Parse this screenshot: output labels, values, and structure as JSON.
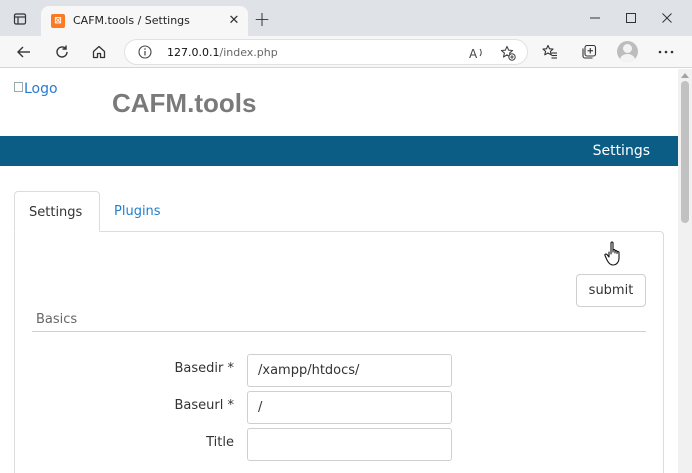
{
  "browser": {
    "tab_title": "CAFM.tools / Settings",
    "tab_close": "✕",
    "new_tab": "+",
    "url_host": "127.0.0.1",
    "url_path": "/index.php",
    "icons": [
      "tab-actions-icon",
      "favicon-icon",
      "close-icon",
      "new-tab-icon",
      "minimize-icon",
      "maximize-icon",
      "window-close-icon",
      "back-icon",
      "refresh-icon",
      "home-icon",
      "site-info-icon",
      "read-aloud-icon",
      "add-favorite-icon",
      "favorites-icon",
      "collections-icon",
      "profile-icon",
      "more-icon"
    ]
  },
  "page": {
    "logo_alt": "Logo",
    "site_title": "CAFM.tools",
    "nav_settings": "Settings",
    "tabs": [
      {
        "label": "Settings",
        "active": true
      },
      {
        "label": "Plugins",
        "active": false
      }
    ],
    "submit_label": "submit",
    "section_basics": "Basics",
    "fields": [
      {
        "label": "Basedir *",
        "value": "/xampp/htdocs/"
      },
      {
        "label": "Baseurl *",
        "value": "/"
      },
      {
        "label": "Title",
        "value": ""
      }
    ]
  },
  "colors": {
    "navbar": "#0b5d86",
    "link": "#1f7fcf",
    "title_gray": "#7a7a7a",
    "favicon": "#fb7a24"
  }
}
